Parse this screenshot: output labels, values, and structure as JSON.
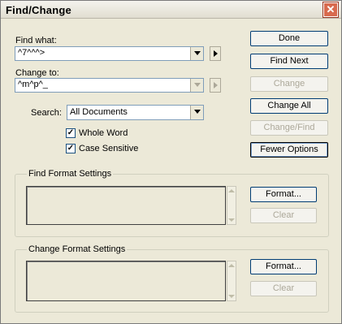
{
  "window": {
    "title": "Find/Change",
    "close_glyph": "✕"
  },
  "find": {
    "label": "Find what:",
    "value": "^7^^^>"
  },
  "change": {
    "label": "Change to:",
    "value": "^m^p^_"
  },
  "search": {
    "label": "Search:",
    "value": "All Documents"
  },
  "options": {
    "whole_word": {
      "label": "Whole Word",
      "checked": true
    },
    "case_sensitive": {
      "label": "Case Sensitive",
      "checked": true
    }
  },
  "buttons": {
    "done": "Done",
    "find_next": "Find Next",
    "change": "Change",
    "change_all": "Change All",
    "change_find": "Change/Find",
    "fewer_options": "Fewer Options"
  },
  "find_format": {
    "title": "Find Format Settings",
    "format": "Format...",
    "clear": "Clear"
  },
  "change_format": {
    "title": "Change Format Settings",
    "format": "Format...",
    "clear": "Clear"
  },
  "check_glyph": "✓"
}
